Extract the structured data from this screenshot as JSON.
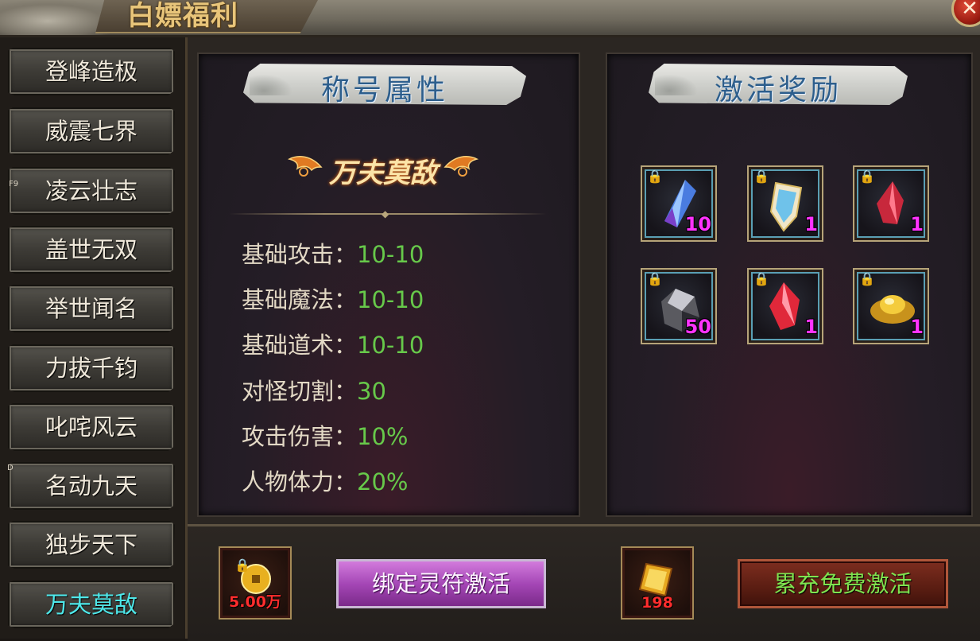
{
  "header": {
    "title": "白嫖福利",
    "close_label": "✕"
  },
  "nav": {
    "items": [
      {
        "label": "登峰造极"
      },
      {
        "label": "威震七界"
      },
      {
        "label": "凌云壮志",
        "hotkey": "F9"
      },
      {
        "label": "盖世无双"
      },
      {
        "label": "举世闻名"
      },
      {
        "label": "力拔千钧"
      },
      {
        "label": "叱咤风云"
      },
      {
        "label": "名动九天",
        "hotkey": "D"
      },
      {
        "label": "独步天下"
      },
      {
        "label": "万夫莫敌",
        "active": true
      }
    ]
  },
  "attributes_panel": {
    "heading": "称号属性",
    "title_name": "万夫莫敌",
    "rows": [
      {
        "label": "基础攻击：",
        "value": "10-10"
      },
      {
        "label": "基础魔法：",
        "value": "10-10"
      },
      {
        "label": "基础道术：",
        "value": "10-10"
      },
      {
        "label": "对怪切割：",
        "value": "30"
      },
      {
        "label": "攻击伤害：",
        "value": "10%"
      },
      {
        "label": "人物体力：",
        "value": "20%"
      }
    ]
  },
  "rewards_panel": {
    "heading": "激活奖励",
    "items": [
      {
        "icon": "blue-crystal-icon",
        "count": "10",
        "locked": true
      },
      {
        "icon": "shield-gem-icon",
        "count": "1",
        "locked": true
      },
      {
        "icon": "red-crystal-icon",
        "count": "1",
        "locked": true
      },
      {
        "icon": "ore-icon",
        "count": "50",
        "locked": true
      },
      {
        "icon": "red-gem-icon",
        "count": "1",
        "locked": true
      },
      {
        "icon": "gold-ingot-icon",
        "count": "1",
        "locked": true
      }
    ]
  },
  "bottom": {
    "cost_bound": {
      "icon": "gold-coin-icon",
      "amount": "5.00万",
      "locked": true
    },
    "bound_button_label": "绑定灵符激活",
    "cost_recharge": {
      "icon": "talisman-icon",
      "amount": "198"
    },
    "recharge_button_label": "累充免费激活"
  },
  "colors": {
    "attr_value": "#67c94a",
    "active_nav": "#4ee8ea",
    "item_count": "#ff33ff",
    "cost_count": "#ff2d2d"
  }
}
